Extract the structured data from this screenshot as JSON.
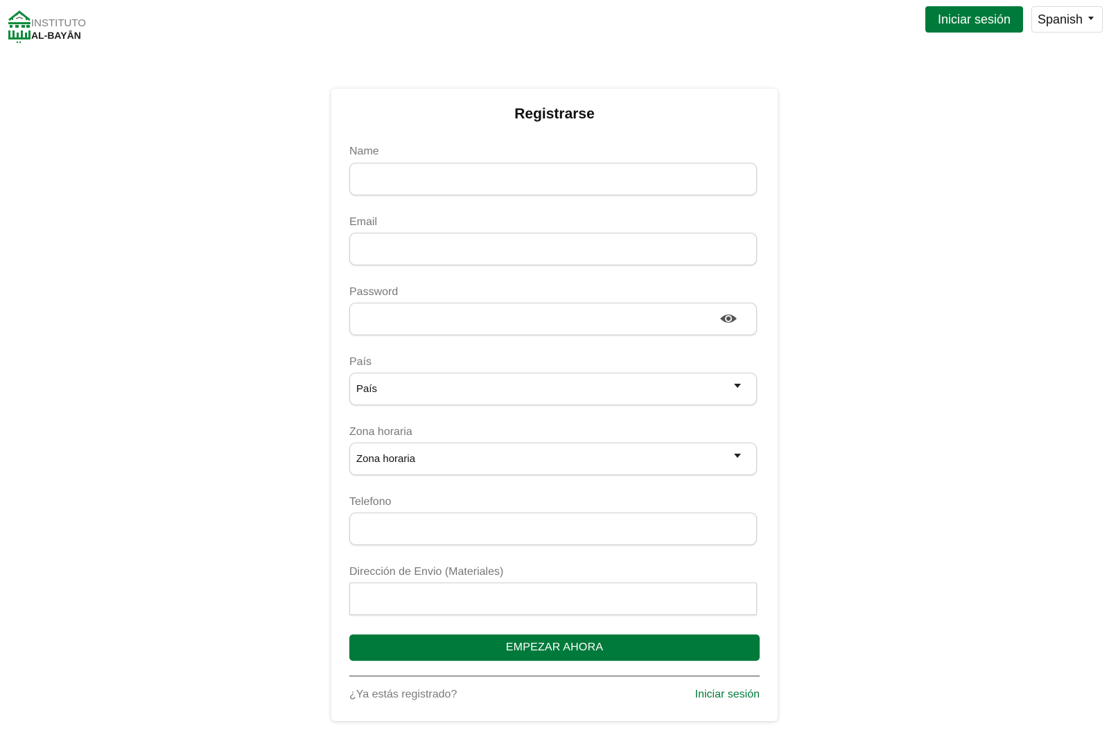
{
  "header": {
    "logo": {
      "arabic_text": "معهد البيان",
      "line1": "INSTITUTO",
      "line2": "AL-BAYĀN"
    },
    "login_button": "Iniciar sesión",
    "language": {
      "selected": "Spanish"
    }
  },
  "form": {
    "title": "Registrarse",
    "fields": {
      "name": {
        "label": "Name",
        "value": ""
      },
      "email": {
        "label": "Email",
        "value": ""
      },
      "password": {
        "label": "Password",
        "value": ""
      },
      "country": {
        "label": "País",
        "selected": "País"
      },
      "timezone": {
        "label": "Zona horaria",
        "selected": "Zona horaria"
      },
      "phone": {
        "label": "Telefono",
        "value": ""
      },
      "address": {
        "label": "Dirección de Envio (Materiales)",
        "value": ""
      }
    },
    "submit_label": "EMPEZAR AHORA",
    "footer": {
      "question": "¿Ya estás registrado?",
      "login_link": "Iniciar sesión"
    }
  },
  "colors": {
    "brand_green": "#007a3a",
    "label_gray": "#777777",
    "border_gray": "#cfcfcf"
  },
  "icons": {
    "password_toggle": "eye-icon",
    "select_caret": "caret-down-icon"
  }
}
